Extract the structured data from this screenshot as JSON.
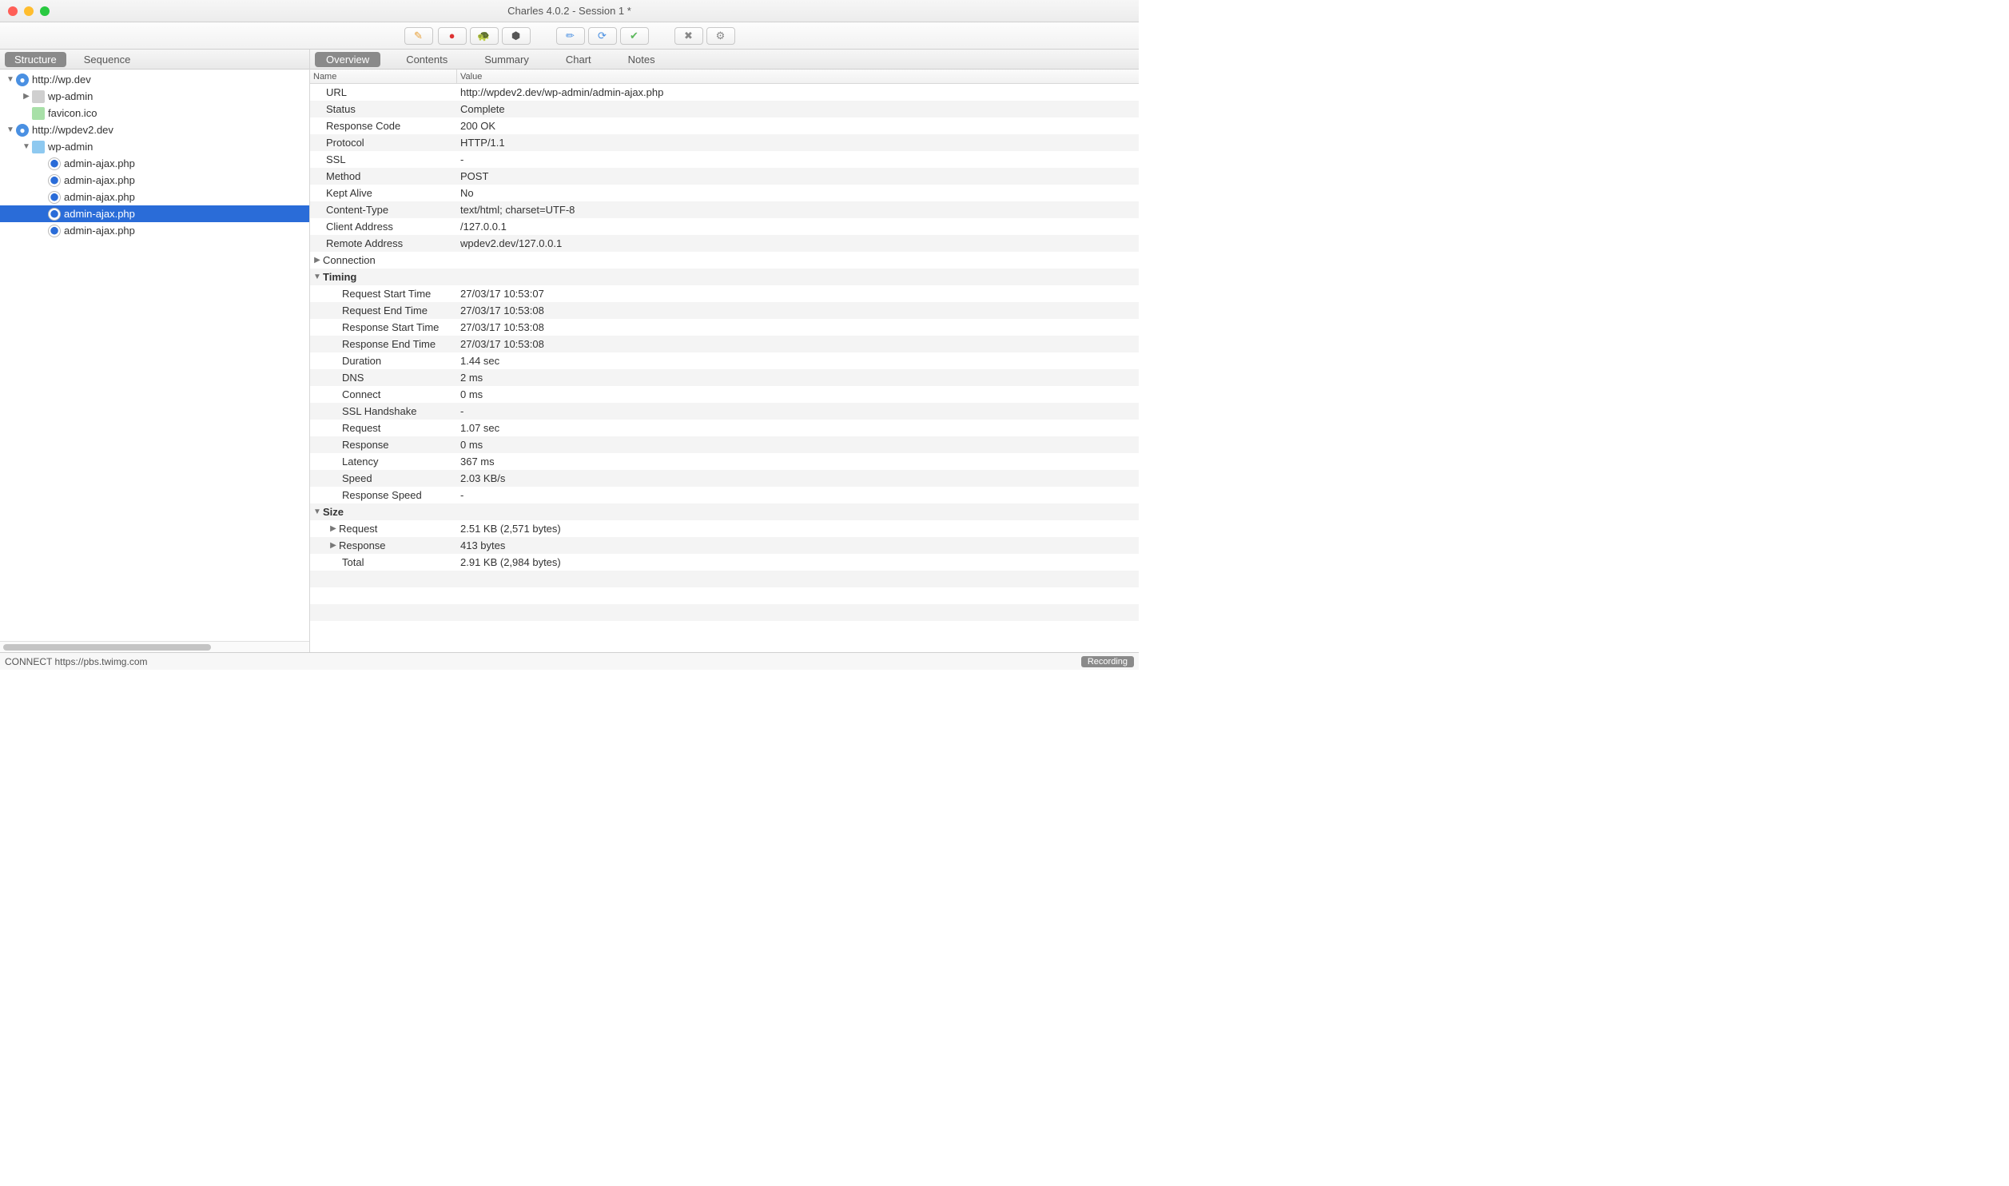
{
  "window": {
    "title": "Charles 4.0.2 - Session 1 *"
  },
  "sidebar_tabs": {
    "structure": "Structure",
    "sequence": "Sequence"
  },
  "tree": [
    {
      "kind": "host",
      "label": "http://wp.dev",
      "indent": 0,
      "expanded": true,
      "selected": false
    },
    {
      "kind": "folder-closed",
      "label": "wp-admin",
      "indent": 1,
      "expanded": false,
      "selected": false
    },
    {
      "kind": "image",
      "label": "favicon.ico",
      "indent": 1,
      "expanded": null,
      "selected": false
    },
    {
      "kind": "host",
      "label": "http://wpdev2.dev",
      "indent": 0,
      "expanded": true,
      "selected": false
    },
    {
      "kind": "folder",
      "label": "wp-admin",
      "indent": 1,
      "expanded": true,
      "selected": false
    },
    {
      "kind": "file",
      "label": "admin-ajax.php",
      "indent": 2,
      "expanded": null,
      "selected": false
    },
    {
      "kind": "file",
      "label": "admin-ajax.php",
      "indent": 2,
      "expanded": null,
      "selected": false
    },
    {
      "kind": "file",
      "label": "admin-ajax.php",
      "indent": 2,
      "expanded": null,
      "selected": false
    },
    {
      "kind": "file",
      "label": "admin-ajax.php",
      "indent": 2,
      "expanded": null,
      "selected": true
    },
    {
      "kind": "file",
      "label": "admin-ajax.php",
      "indent": 2,
      "expanded": null,
      "selected": false
    }
  ],
  "detail_tabs": [
    "Overview",
    "Contents",
    "Summary",
    "Chart",
    "Notes"
  ],
  "detail_active": "Overview",
  "headers": {
    "name": "Name",
    "value": "Value"
  },
  "details": [
    {
      "n": "URL",
      "v": "http://wpdev2.dev/wp-admin/admin-ajax.php",
      "indent": 1,
      "disc": null
    },
    {
      "n": "Status",
      "v": "Complete",
      "indent": 1,
      "disc": null
    },
    {
      "n": "Response Code",
      "v": "200 OK",
      "indent": 1,
      "disc": null
    },
    {
      "n": "Protocol",
      "v": "HTTP/1.1",
      "indent": 1,
      "disc": null
    },
    {
      "n": "SSL",
      "v": "-",
      "indent": 1,
      "disc": null
    },
    {
      "n": "Method",
      "v": "POST",
      "indent": 1,
      "disc": null
    },
    {
      "n": "Kept Alive",
      "v": "No",
      "indent": 1,
      "disc": null
    },
    {
      "n": "Content-Type",
      "v": "text/html; charset=UTF-8",
      "indent": 1,
      "disc": null
    },
    {
      "n": "Client Address",
      "v": "/127.0.0.1",
      "indent": 1,
      "disc": null
    },
    {
      "n": "Remote Address",
      "v": "wpdev2.dev/127.0.0.1",
      "indent": 1,
      "disc": null
    },
    {
      "n": "Connection",
      "v": "",
      "indent": 1,
      "disc": "right"
    },
    {
      "n": "Timing",
      "v": "",
      "indent": 1,
      "disc": "down",
      "bold": true
    },
    {
      "n": "Request Start Time",
      "v": "27/03/17 10:53:07",
      "indent": 2,
      "disc": null
    },
    {
      "n": "Request End Time",
      "v": "27/03/17 10:53:08",
      "indent": 2,
      "disc": null
    },
    {
      "n": "Response Start Time",
      "v": "27/03/17 10:53:08",
      "indent": 2,
      "disc": null
    },
    {
      "n": "Response End Time",
      "v": "27/03/17 10:53:08",
      "indent": 2,
      "disc": null
    },
    {
      "n": "Duration",
      "v": "1.44 sec",
      "indent": 2,
      "disc": null
    },
    {
      "n": "DNS",
      "v": "2 ms",
      "indent": 2,
      "disc": null
    },
    {
      "n": "Connect",
      "v": "0 ms",
      "indent": 2,
      "disc": null
    },
    {
      "n": "SSL Handshake",
      "v": "-",
      "indent": 2,
      "disc": null
    },
    {
      "n": "Request",
      "v": "1.07 sec",
      "indent": 2,
      "disc": null
    },
    {
      "n": "Response",
      "v": "0 ms",
      "indent": 2,
      "disc": null
    },
    {
      "n": "Latency",
      "v": "367 ms",
      "indent": 2,
      "disc": null
    },
    {
      "n": "Speed",
      "v": "2.03 KB/s",
      "indent": 2,
      "disc": null
    },
    {
      "n": "Response Speed",
      "v": "-",
      "indent": 2,
      "disc": null
    },
    {
      "n": "Size",
      "v": "",
      "indent": 1,
      "disc": "down",
      "bold": true
    },
    {
      "n": "Request",
      "v": "2.51 KB (2,571 bytes)",
      "indent": 2,
      "disc": "right"
    },
    {
      "n": "Response",
      "v": "413 bytes",
      "indent": 2,
      "disc": "right"
    },
    {
      "n": "Total",
      "v": "2.91 KB (2,984 bytes)",
      "indent": 2,
      "disc": null
    }
  ],
  "status": {
    "left": "CONNECT https://pbs.twimg.com",
    "right": "Recording"
  },
  "toolbar_icons": [
    "broom",
    "record",
    "turtle",
    "hex",
    "pencil",
    "refresh",
    "check",
    "tools",
    "gear"
  ]
}
